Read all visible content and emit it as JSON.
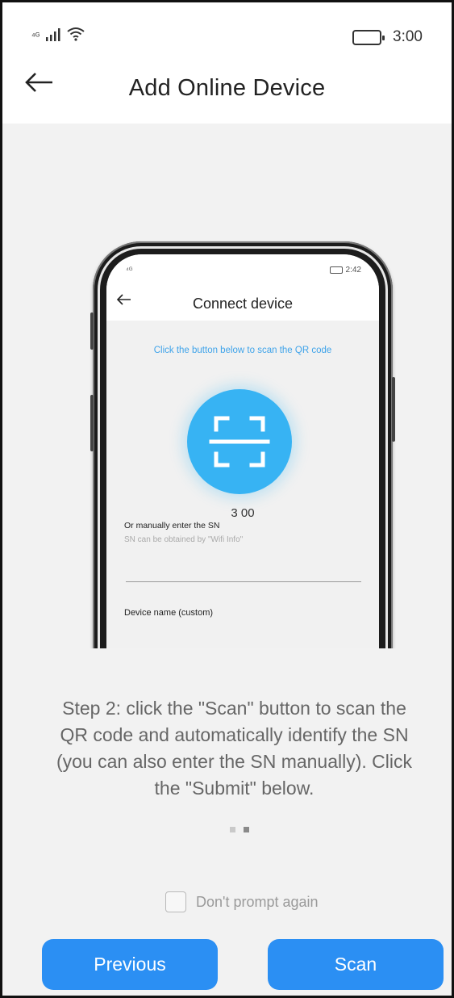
{
  "status_bar": {
    "signal_text": "⁴ᴳ",
    "time": "3:00"
  },
  "header": {
    "title": "Add Online Device",
    "back_icon": "arrow-left-icon"
  },
  "illustration": {
    "mini_status_signal": "⁴ᴳ",
    "mini_status_time": "2:42",
    "title": "Connect device",
    "hint": "Click the button below to scan the QR code",
    "scan_icon": "scan-frame-icon",
    "sn_value": "3 00",
    "manual_label": "Or manually enter the SN",
    "sn_hint": "SN can be obtained by \"Wifi Info\"",
    "device_name_label": "Device name (custom)"
  },
  "step_text": "Step 2: click the \"Scan\" button to scan the QR code and automatically identify the SN (you can also enter the SN manually). Click the \"Submit\" below.",
  "pager": {
    "count": 2,
    "active_index": 1
  },
  "prompt": {
    "label": "Don't prompt again",
    "checked": false
  },
  "buttons": {
    "previous": "Previous",
    "scan": "Scan"
  },
  "colors": {
    "accent": "#2b8ff3",
    "scan_circle": "#37b3f3",
    "hint_text": "#3ea3ea"
  }
}
